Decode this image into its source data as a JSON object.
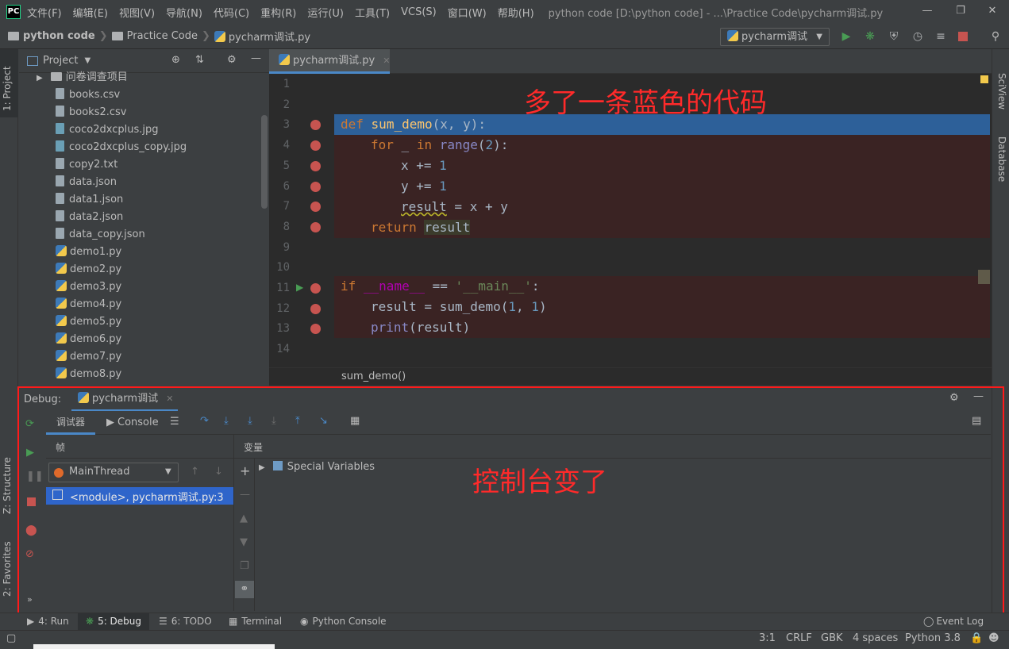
{
  "menubar": {
    "logo_text": "PC",
    "items": [
      "文件(F)",
      "编辑(E)",
      "视图(V)",
      "导航(N)",
      "代码(C)",
      "重构(R)",
      "运行(U)",
      "工具(T)",
      "VCS(S)",
      "窗口(W)",
      "帮助(H)"
    ],
    "window_title": "python code [D:\\python code] - ...\\Practice Code\\pycharm调试.py"
  },
  "navbar": {
    "crumbs": [
      "python code",
      "Practice Code",
      "pycharm调试.py"
    ],
    "run_config": "pycharm调试"
  },
  "project": {
    "title": "Project",
    "tree": [
      {
        "name": "问卷调查项目",
        "kind": "folder"
      },
      {
        "name": "books.csv",
        "kind": "file"
      },
      {
        "name": "books2.csv",
        "kind": "file"
      },
      {
        "name": "coco2dxcplus.jpg",
        "kind": "image"
      },
      {
        "name": "coco2dxcplus_copy.jpg",
        "kind": "image"
      },
      {
        "name": "copy2.txt",
        "kind": "file"
      },
      {
        "name": "data.json",
        "kind": "json"
      },
      {
        "name": "data1.json",
        "kind": "json"
      },
      {
        "name": "data2.json",
        "kind": "json"
      },
      {
        "name": "data_copy.json",
        "kind": "json"
      },
      {
        "name": "demo1.py",
        "kind": "python"
      },
      {
        "name": "demo2.py",
        "kind": "python"
      },
      {
        "name": "demo3.py",
        "kind": "python"
      },
      {
        "name": "demo4.py",
        "kind": "python"
      },
      {
        "name": "demo5.py",
        "kind": "python"
      },
      {
        "name": "demo6.py",
        "kind": "python"
      },
      {
        "name": "demo7.py",
        "kind": "python"
      },
      {
        "name": "demo8.py",
        "kind": "python"
      }
    ]
  },
  "editor": {
    "tab": "pycharm调试.py",
    "line_numbers": [
      "1",
      "2",
      "3",
      "4",
      "5",
      "6",
      "7",
      "8",
      "9",
      "10",
      "11",
      "12",
      "13",
      "14"
    ],
    "breadcrumb": "sum_demo()",
    "annotation": "多了一条蓝色的代码"
  },
  "code": {
    "l3": [
      "def",
      "sum_demo",
      "(x, y):"
    ],
    "l4": [
      "for",
      " _ ",
      "in",
      " ",
      "range",
      "(",
      "2",
      "):"
    ],
    "l5": [
      "x += ",
      "1"
    ],
    "l6": [
      "y += ",
      "1"
    ],
    "l7": [
      "result",
      " = x + y"
    ],
    "l8": [
      "return",
      "result"
    ],
    "l11": [
      "if",
      "__name__",
      " == ",
      "'__main__'",
      ":"
    ],
    "l12": [
      "result = sum_demo(",
      "1",
      ", ",
      "1",
      ")"
    ],
    "l13": [
      "print",
      "(result)"
    ]
  },
  "debug": {
    "label": "Debug:",
    "session": "pycharm调试",
    "tab_debugger": "调试器",
    "tab_console": "Console",
    "frames_label": "帧",
    "variables_label": "变量",
    "thread": "MainThread",
    "frame": "<module>, pycharm调试.py:3",
    "special_vars": "Special Variables",
    "annotation": "控制台变了"
  },
  "left_strip": {
    "project": "1: Project",
    "structure": "Z: Structure",
    "favorites": "2: Favorites"
  },
  "right_strip": {
    "sciview": "SciView",
    "database": "Database"
  },
  "bottom_tabs": {
    "run": "4: Run",
    "debug": "5: Debug",
    "todo": "6: TODO",
    "terminal": "Terminal",
    "pyconsole": "Python Console",
    "eventlog": "Event Log"
  },
  "status": {
    "position": "3:1",
    "line_sep": "CRLF",
    "encoding": "GBK",
    "indent": "4 spaces",
    "interpreter": "Python 3.8"
  },
  "colors": {
    "accent": "#4a88c7",
    "breakpoint": "#c75450",
    "highlight_line": "#2d6099",
    "annotation": "#ff2a2a"
  }
}
